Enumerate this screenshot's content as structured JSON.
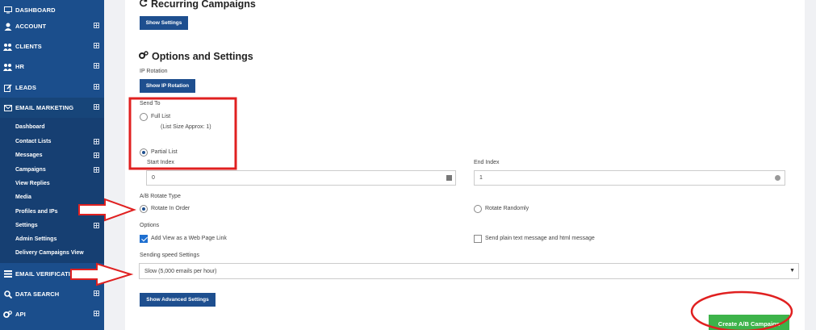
{
  "sidebar": {
    "items": [
      {
        "label": "DASHBOARD",
        "icon": "monitor-icon"
      },
      {
        "label": "ACCOUNT",
        "icon": "user-icon"
      },
      {
        "label": "CLIENTS",
        "icon": "users-icon"
      },
      {
        "label": "HR",
        "icon": "users-icon"
      },
      {
        "label": "LEADS",
        "icon": "edit-icon"
      },
      {
        "label": "EMAIL MARKETING",
        "icon": "envelope-icon"
      }
    ],
    "sub_items": [
      "Dashboard",
      "Contact Lists",
      "Messages",
      "Campaigns",
      "View Replies",
      "Media",
      "Profiles and IPs",
      "Settings",
      "Admin Settings",
      "Delivery Campaigns View"
    ],
    "bottom_items": [
      {
        "label": "EMAIL VERIFICATI  ON",
        "icon": "list-icon"
      },
      {
        "label": "DATA SEARCH",
        "icon": "search-icon"
      },
      {
        "label": "API",
        "icon": "gears-icon"
      }
    ]
  },
  "main": {
    "recurring_title": "Recurring Campaigns",
    "show_settings": "Show Settings",
    "options_title": "Options and Settings",
    "ip_rotation_label": "IP Rotation",
    "show_ip_rotation": "Show IP Rotation",
    "send_to_label": "Send To",
    "full_list": "Full List",
    "list_size": "(List Size Approx: 1)",
    "partial_list": "Partial List",
    "start_index_label": "Start Index",
    "start_index_value": "0",
    "end_index_label": "End Index",
    "end_index_value": "1",
    "ab_rotate_label": "A/B Rotate Type",
    "rotate_in_order": "Rotate In Order",
    "rotate_randomly": "Rotate Randomly",
    "options_label": "Options",
    "add_view_link": "Add View as a Web Page Link",
    "send_plain_text": "Send plain text message and html message",
    "speed_label": "Sending speed Settings",
    "speed_value": "Slow (5,000 emails per hour)",
    "show_advanced": "Show Advanced Settings",
    "create_ab": "Create A/B Campaign"
  },
  "colors": {
    "sidebar": "#1b4e8c",
    "button": "#1e4f8f",
    "create_button": "#3db34a",
    "annotation": "#e02020"
  }
}
